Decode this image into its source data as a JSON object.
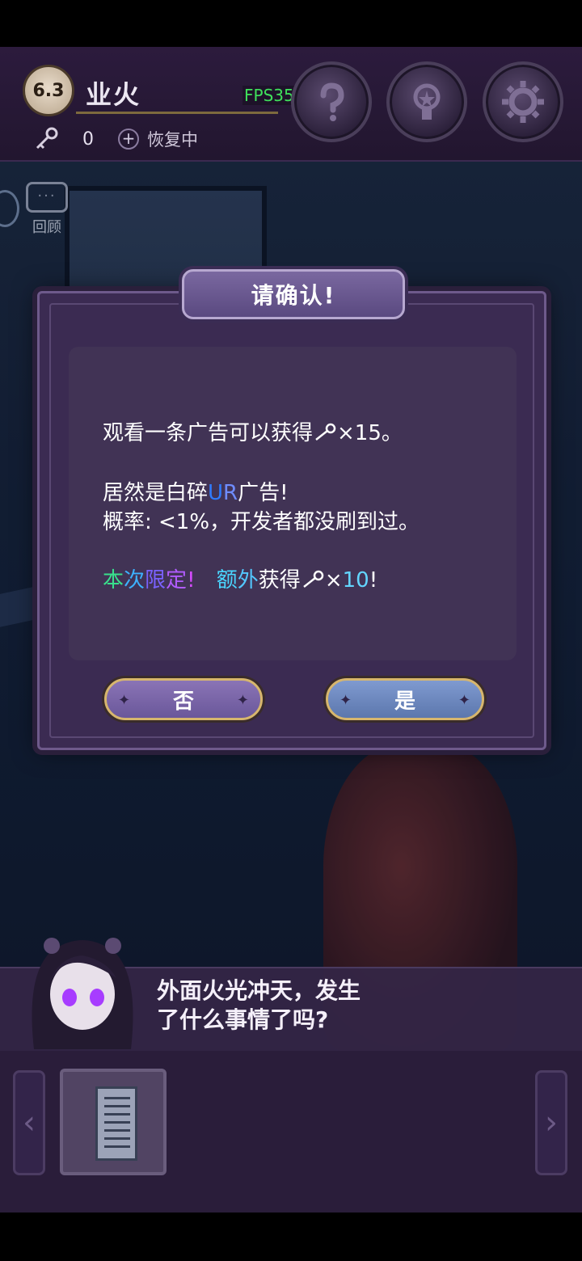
{
  "header": {
    "chapter": "6.3",
    "title": "业火",
    "fps": "FPS35",
    "keys": "0",
    "recover": "恢复中"
  },
  "scene": {
    "review_label": "回顾"
  },
  "dialog": {
    "title": "请确认!",
    "line1_pre": "观看一条广告可以获得",
    "line1_post": "×15。",
    "line2_pre": "居然是白碎",
    "line2_u": "U",
    "line2_r": "R",
    "line2_post": "广告!",
    "line3": "概率: <1%，开发者都没刷到过。",
    "line4_ben": "本",
    "line4_ci": "次",
    "line4_xian": "限",
    "line4_ding": "定",
    "line4_ex": "!",
    "line4_e": "额",
    "line4_wai": "外",
    "line4_rest": "获得",
    "line4_times": "×",
    "line4_num": "10",
    "line4_end": "!",
    "no_label": "否",
    "yes_label": "是"
  },
  "talk": {
    "text": "外面火光冲天，发生\n了什么事情了吗?"
  },
  "colors": {
    "accent_gold": "#d7b66d",
    "fps_green": "#3fe05b"
  }
}
